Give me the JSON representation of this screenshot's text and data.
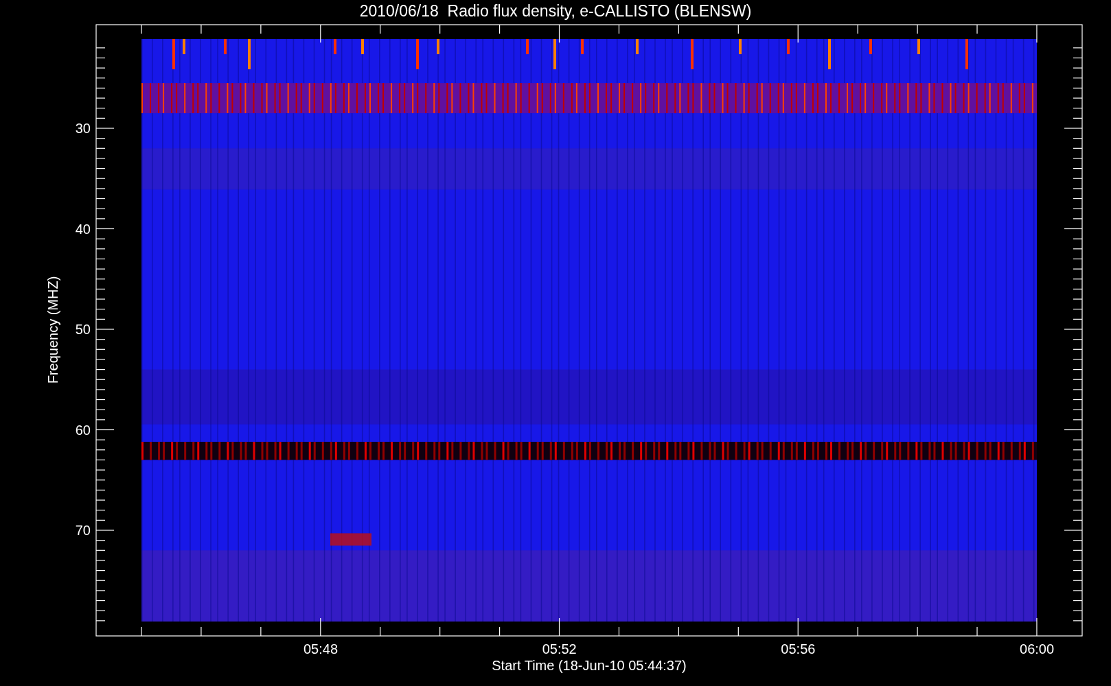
{
  "title": "2010/06/18  Radio flux density, e-CALLISTO (BLENSW)",
  "y_axis": {
    "label": "Frequency (MHZ)",
    "ticks": [
      "30",
      "40",
      "50",
      "60",
      "70"
    ]
  },
  "x_axis": {
    "label": "Start Time (18-Jun-10 05:44:37)",
    "ticks": [
      "05:48",
      "05:52",
      "05:56",
      "06:00"
    ]
  }
}
